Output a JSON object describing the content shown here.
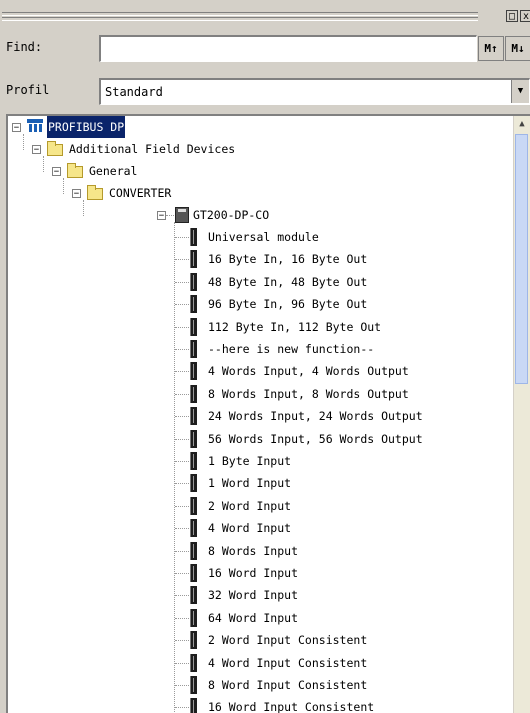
{
  "find": {
    "label": "Find:",
    "value": "",
    "up_icon": "find-up-icon",
    "down_icon": "find-down-icon"
  },
  "profil": {
    "label": "Profil",
    "value": "Standard"
  },
  "window": {
    "max": "□",
    "close": "x"
  },
  "tree": {
    "root": "PROFIBUS DP",
    "level1": "Additional Field Devices",
    "level2": "General",
    "level3": "CONVERTER",
    "device": "GT200-DP-CO",
    "modules": [
      "Universal module",
      "16 Byte In, 16 Byte Out",
      "48 Byte In, 48 Byte Out",
      "96 Byte In, 96 Byte Out",
      "112 Byte In, 112 Byte Out",
      "--here is new function--",
      "4 Words Input, 4 Words Output",
      "8 Words Input, 8 Words Output",
      "24 Words Input, 24 Words Output",
      "56 Words Input, 56 Words Output",
      "1 Byte Input",
      "1 Word Input",
      "2 Word Input",
      "4 Word Input",
      "8 Words Input",
      "16 Word Input",
      "32 Word Input",
      "64 Word Input",
      "2 Word Input Consistent",
      "4 Word Input Consistent",
      "8 Word Input Consistent",
      "16 Word Input Consistent"
    ]
  }
}
